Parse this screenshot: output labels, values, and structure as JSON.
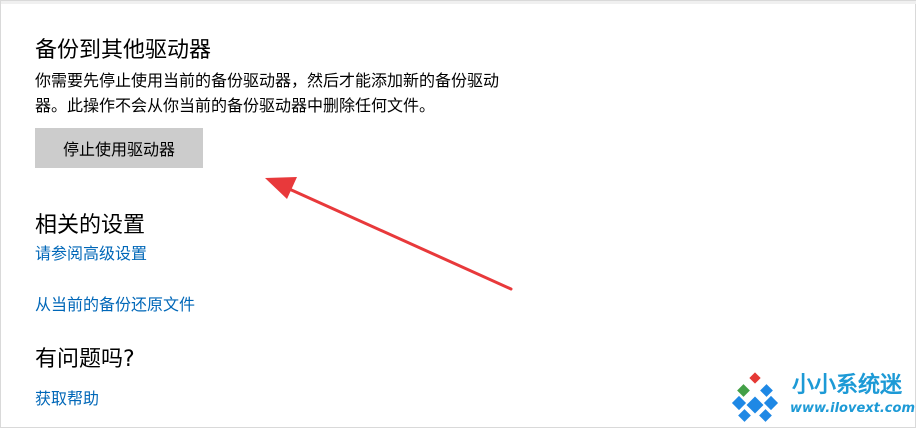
{
  "backup_section": {
    "title": "备份到其他驱动器",
    "description_line1": "你需要先停止使用当前的备份驱动器，然后才能添加新的备份驱动",
    "description_line2": "器。此操作不会从你当前的备份驱动器中删除任何文件。",
    "stop_button_label": "停止使用驱动器"
  },
  "related_section": {
    "title": "相关的设置",
    "links": [
      {
        "label": "请参阅高级设置"
      },
      {
        "label": "从当前的备份还原文件"
      }
    ]
  },
  "help_section": {
    "title": "有问题吗?",
    "link_label": "获取帮助"
  },
  "watermark": {
    "brand": "小小系统迷",
    "url": "www.ilovext.com",
    "logo_icon": "windows-style-logo-icon"
  },
  "annotation": {
    "arrow_color": "#e8393b",
    "arrow_icon": "red-arrow-icon"
  },
  "colors": {
    "link": "#0067b8",
    "button_bg": "#cccccc",
    "watermark": "#1d9ad6"
  }
}
